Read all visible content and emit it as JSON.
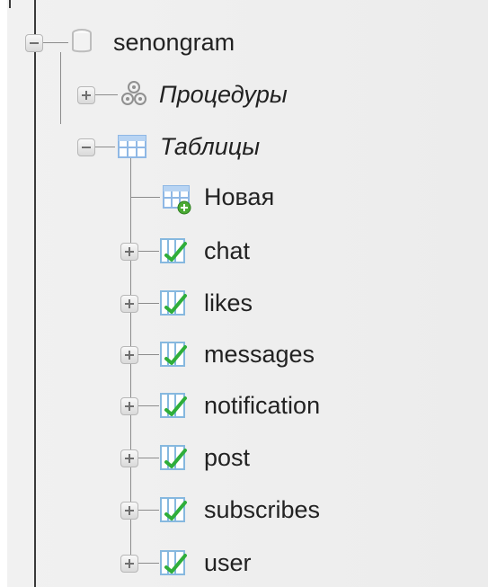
{
  "tree": {
    "database": {
      "name": "senongram",
      "icon": "database-icon"
    },
    "procedures": {
      "label": "Процедуры",
      "icon": "procedures-icon"
    },
    "tables_group": {
      "label": "Таблицы",
      "icon": "tables-icon"
    },
    "new_table": {
      "label": "Новая",
      "icon": "new-table-icon"
    },
    "tables": [
      {
        "label": "chat",
        "icon": "table-icon"
      },
      {
        "label": "likes",
        "icon": "table-icon"
      },
      {
        "label": "messages",
        "icon": "table-icon"
      },
      {
        "label": "notification",
        "icon": "table-icon"
      },
      {
        "label": "post",
        "icon": "table-icon"
      },
      {
        "label": "subscribes",
        "icon": "table-icon"
      },
      {
        "label": "user",
        "icon": "table-icon"
      }
    ]
  },
  "colors": {
    "panel_background": "#ececec",
    "text": "#222222",
    "table_icon_accent": "#2fae3a"
  }
}
